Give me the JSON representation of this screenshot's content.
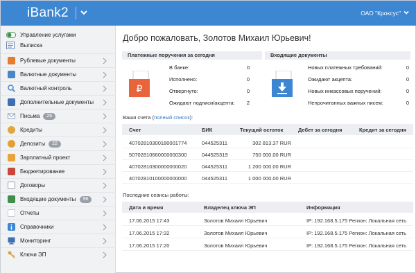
{
  "header": {
    "logo": "iBank2",
    "org_name": "ОАО \"Кроксус\""
  },
  "sidebar": {
    "service_items": [
      {
        "label": "Управление услугами",
        "icon": "toggle-icon"
      },
      {
        "label": "Выписка",
        "icon": "statement-icon"
      }
    ],
    "items": [
      {
        "label": "Рублевые документы",
        "icon": "ruble-docs-icon",
        "badge": "",
        "color": "#e77b2e"
      },
      {
        "label": "Валютные документы",
        "icon": "currency-docs-icon",
        "badge": "",
        "color": "#4a87c9"
      },
      {
        "label": "Валютный контроль",
        "icon": "magnifier-icon",
        "badge": "",
        "color": "#4a87c9"
      },
      {
        "label": "Дополнительные документы",
        "icon": "extra-docs-icon",
        "badge": "",
        "color": "#3e6fb5"
      },
      {
        "label": "Письма",
        "icon": "letters-icon",
        "badge": "26",
        "color": "#8aa1c0"
      },
      {
        "label": "Кредиты",
        "icon": "credits-icon",
        "badge": "",
        "color": "#e0a83a"
      },
      {
        "label": "Депозиты",
        "icon": "deposits-icon",
        "badge": "22",
        "color": "#e2a136"
      },
      {
        "label": "Зарплатный проект",
        "icon": "salary-icon",
        "badge": "",
        "color": "#e9a33a"
      },
      {
        "label": "Бюджетирование",
        "icon": "budget-icon",
        "badge": "",
        "color": "#c8463a"
      },
      {
        "label": "Договоры",
        "icon": "contracts-icon",
        "badge": "",
        "color": "#9aa0a8"
      },
      {
        "label": "Входящие документы",
        "icon": "incoming-docs-icon",
        "badge": "96",
        "color": "#3f8f4a"
      },
      {
        "label": "Отчеты",
        "icon": "reports-icon",
        "badge": "",
        "color": "#c9ccd2"
      },
      {
        "label": "Справочники",
        "icon": "info-icon",
        "badge": "",
        "color": "#3d86d1"
      },
      {
        "label": "Мониторинг",
        "icon": "monitor-icon",
        "badge": "",
        "color": "#3d6fb3"
      },
      {
        "label": "Ключи ЭП",
        "icon": "key-icon",
        "badge": "",
        "color": "#e2a136"
      }
    ]
  },
  "main": {
    "greeting": "Добро пожаловать, Золотов Михаил Юрьевич!",
    "payments": {
      "title": "Платежные поручения за сегодня",
      "rows": [
        {
          "label": "В банке:",
          "value": "0"
        },
        {
          "label": "Исполнено:",
          "value": "0"
        },
        {
          "label": "Отвергнуто:",
          "value": "0"
        },
        {
          "label": "Ожидают подписи/акцепта:",
          "value": "2"
        }
      ]
    },
    "incoming": {
      "title": "Входящие документы",
      "rows": [
        {
          "label": "Новых платежных требований:",
          "value": "0"
        },
        {
          "label": "Ожидают акцепта:",
          "value": "0"
        },
        {
          "label": "Новых инкассовых поручений:",
          "value": "0"
        },
        {
          "label": "Непрочитанных важных писем:",
          "value": "0"
        }
      ]
    },
    "accounts": {
      "title_prefix": "Ваши счета (",
      "full_list_link": "полный список",
      "title_suffix": "):",
      "columns": [
        "Счет",
        "БИК",
        "Текущий остаток",
        "Дебет за сегодня",
        "Кредит за сегодня"
      ],
      "rows": [
        [
          "40702810300180001774",
          "044525311",
          "302 813.37 RUR",
          "",
          ""
        ],
        [
          "50702810660000000300",
          "044525319",
          "750 000.00 RUR",
          "",
          ""
        ],
        [
          "40702810300000000020",
          "044525311",
          "1 200 000.00 RUR",
          "",
          ""
        ],
        [
          "40702810100000000000",
          "044525311",
          "1 000 000.00 RUR",
          "",
          ""
        ]
      ]
    },
    "sessions": {
      "title": "Последние сеансы работы:",
      "columns": [
        "Дата и время",
        "Владелец ключа ЭП",
        "Информация"
      ],
      "rows": [
        [
          "17.06.2015 17:43",
          "Золотов Михаил Юрьевич",
          "IP: 192.168.5.175 Регион: Локальная сеть"
        ],
        [
          "17.06.2015 17:32",
          "Золотов Михаил Юрьевич",
          "IP: 192.168.5.175 Регион: Локальная сеть"
        ],
        [
          "17.06.2015 17:20",
          "Золотов Михаил Юрьевич",
          "IP: 192.168.5.175 Регион: Локальная сеть"
        ]
      ]
    }
  },
  "colors": {
    "header_bg": "#3d86d1",
    "sidebar_bg": "#f1f2f4",
    "section_bg": "#eceef1",
    "link": "#2f78c8",
    "payments_icon": "#e8643a",
    "incoming_icon": "#3d86d1"
  }
}
